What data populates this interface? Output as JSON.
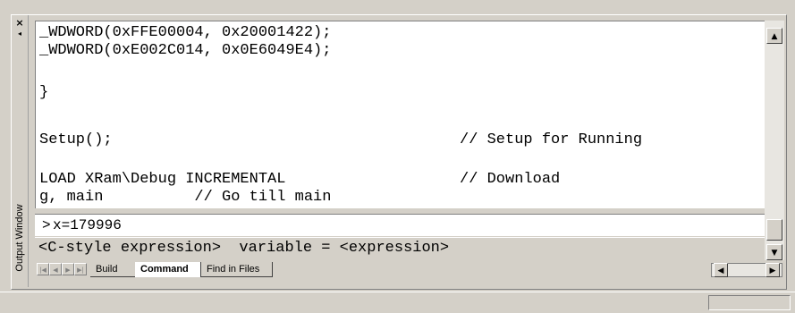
{
  "side_panel": {
    "title": "Output Window",
    "close_glyph": "×",
    "pin_glyph": "◂"
  },
  "editor": {
    "lines": [
      "_WDWORD(0xFFE00004, 0x20001422);",
      "_WDWORD(0xE002C014, 0x0E6049E4);",
      "",
      "}",
      "",
      "Setup();",
      "",
      "LOAD XRam\\Debug INCREMENTAL",
      "g, main          // Go till main"
    ],
    "comments": {
      "setup": "// Setup for Running",
      "load": "// Download"
    }
  },
  "command": {
    "prompt": ">",
    "value": "x=179996"
  },
  "hint": "<C-style expression>  variable = <expression>",
  "tabs": [
    {
      "label": "Build",
      "active": false
    },
    {
      "label": "Command",
      "active": true
    },
    {
      "label": "Find in Files",
      "active": false
    }
  ],
  "scroll_glyphs": {
    "up": "▲",
    "down": "▼",
    "left": "◀",
    "right": "▶",
    "first": "|◀",
    "prev": "◀",
    "next": "▶",
    "last": "▶|"
  }
}
